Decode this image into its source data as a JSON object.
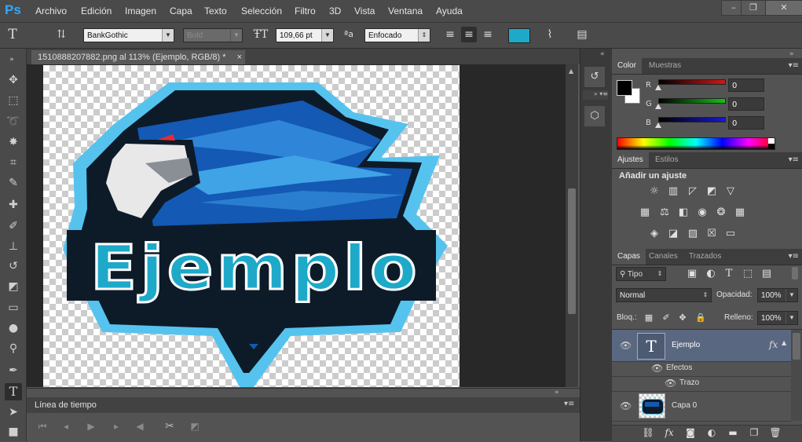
{
  "app": {
    "logo": "Ps"
  },
  "menu": [
    "Archivo",
    "Edición",
    "Imagen",
    "Capa",
    "Texto",
    "Selección",
    "Filtro",
    "3D",
    "Vista",
    "Ventana",
    "Ayuda"
  ],
  "window_controls": {
    "minimize": "–",
    "restore": "❐",
    "close": "✕"
  },
  "options": {
    "font_family": "BankGothic",
    "font_style": "Bold",
    "font_size": "109,66 pt",
    "aa_label": "ªa",
    "antialias": "Enfocado",
    "text_color": "#1ea9c9"
  },
  "document": {
    "tab_title": "1510888207882.png al 113% (Ejemplo, RGB/8) *",
    "close": "×"
  },
  "canvas": {
    "logo_text": "Ejemplo",
    "colors": {
      "dark": "#0d1b29",
      "blue": "#1459b4",
      "light_blue": "#56c3ee",
      "text_fill": "#1ea9c9"
    }
  },
  "timeline": {
    "title": "Línea de tiempo"
  },
  "color_panel": {
    "tabs": [
      "Color",
      "Muestras"
    ],
    "channels": [
      {
        "label": "R",
        "value": "0",
        "color": "#d01818"
      },
      {
        "label": "G",
        "value": "0",
        "color": "#18c018"
      },
      {
        "label": "B",
        "value": "0",
        "color": "#1818d0"
      }
    ],
    "foreground": "#000000",
    "background": "#ffffff"
  },
  "adjustments_panel": {
    "tabs": [
      "Ajustes",
      "Estilos"
    ],
    "title": "Añadir un ajuste"
  },
  "layers_panel": {
    "tabs": [
      "Capas",
      "Canales",
      "Trazados"
    ],
    "filter": "Tipo",
    "blend_mode": "Normal",
    "opacity_label": "Opacidad:",
    "opacity": "100%",
    "lock_label": "Bloq.:",
    "fill_label": "Relleno:",
    "fill": "100%",
    "layers": [
      {
        "name": "Ejemplo",
        "type": "text",
        "fx": "fx",
        "effects_label": "Efectos",
        "effect": "Trazo",
        "selected": true
      },
      {
        "name": "Capa 0",
        "type": "image",
        "selected": false
      }
    ]
  }
}
